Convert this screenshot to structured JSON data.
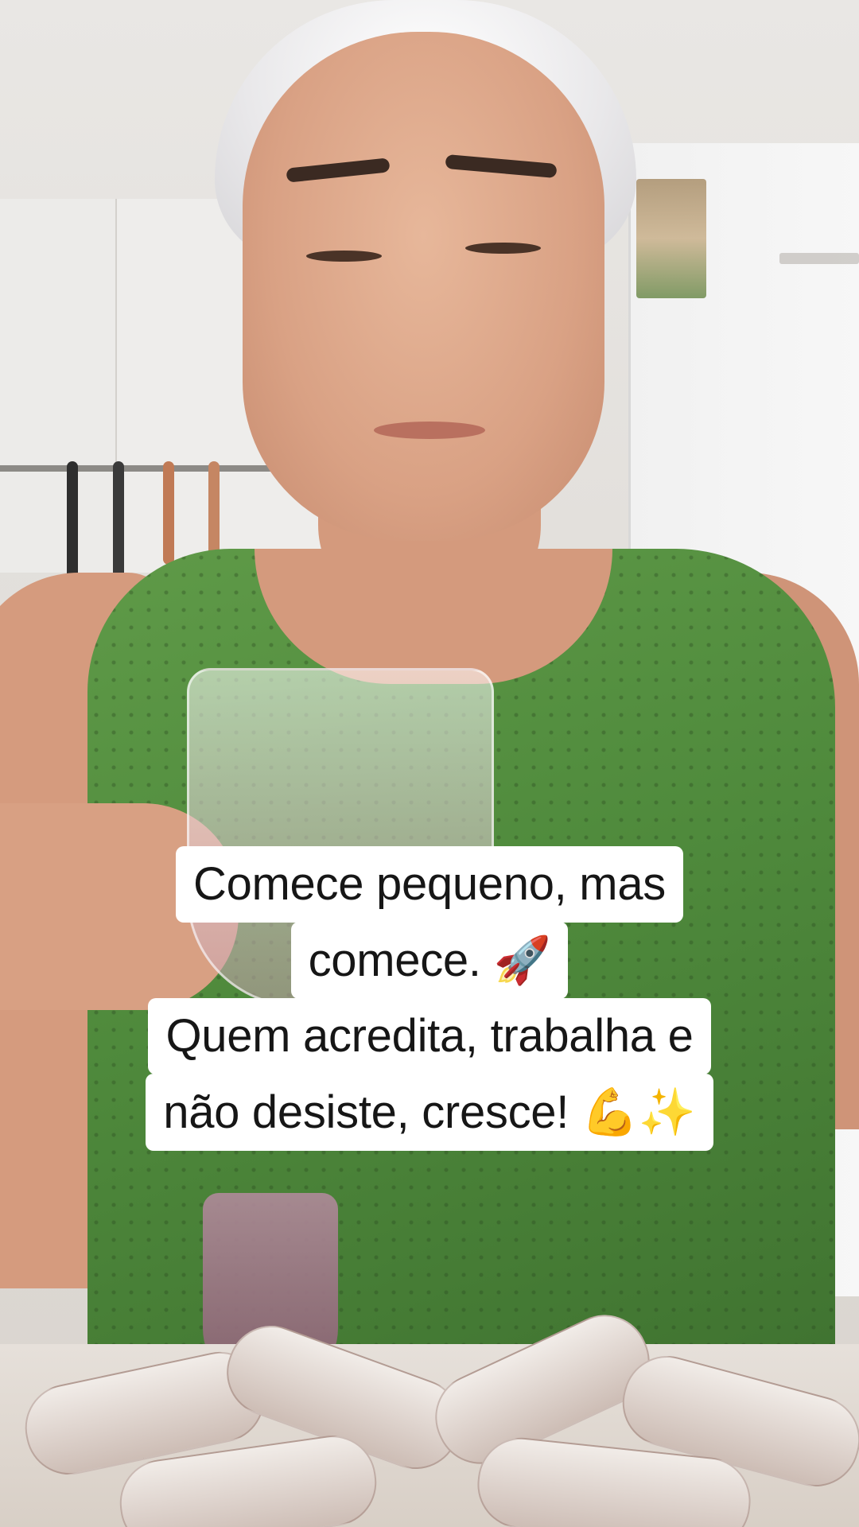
{
  "caption": {
    "lines": [
      {
        "text": "Comece pequeno, mas",
        "emoji": ""
      },
      {
        "text": "comece.",
        "emoji": "🚀"
      },
      {
        "text": "Quem acredita, trabalha e",
        "emoji": ""
      },
      {
        "text": "não desiste, cresce!",
        "emoji": "💪✨"
      }
    ]
  }
}
